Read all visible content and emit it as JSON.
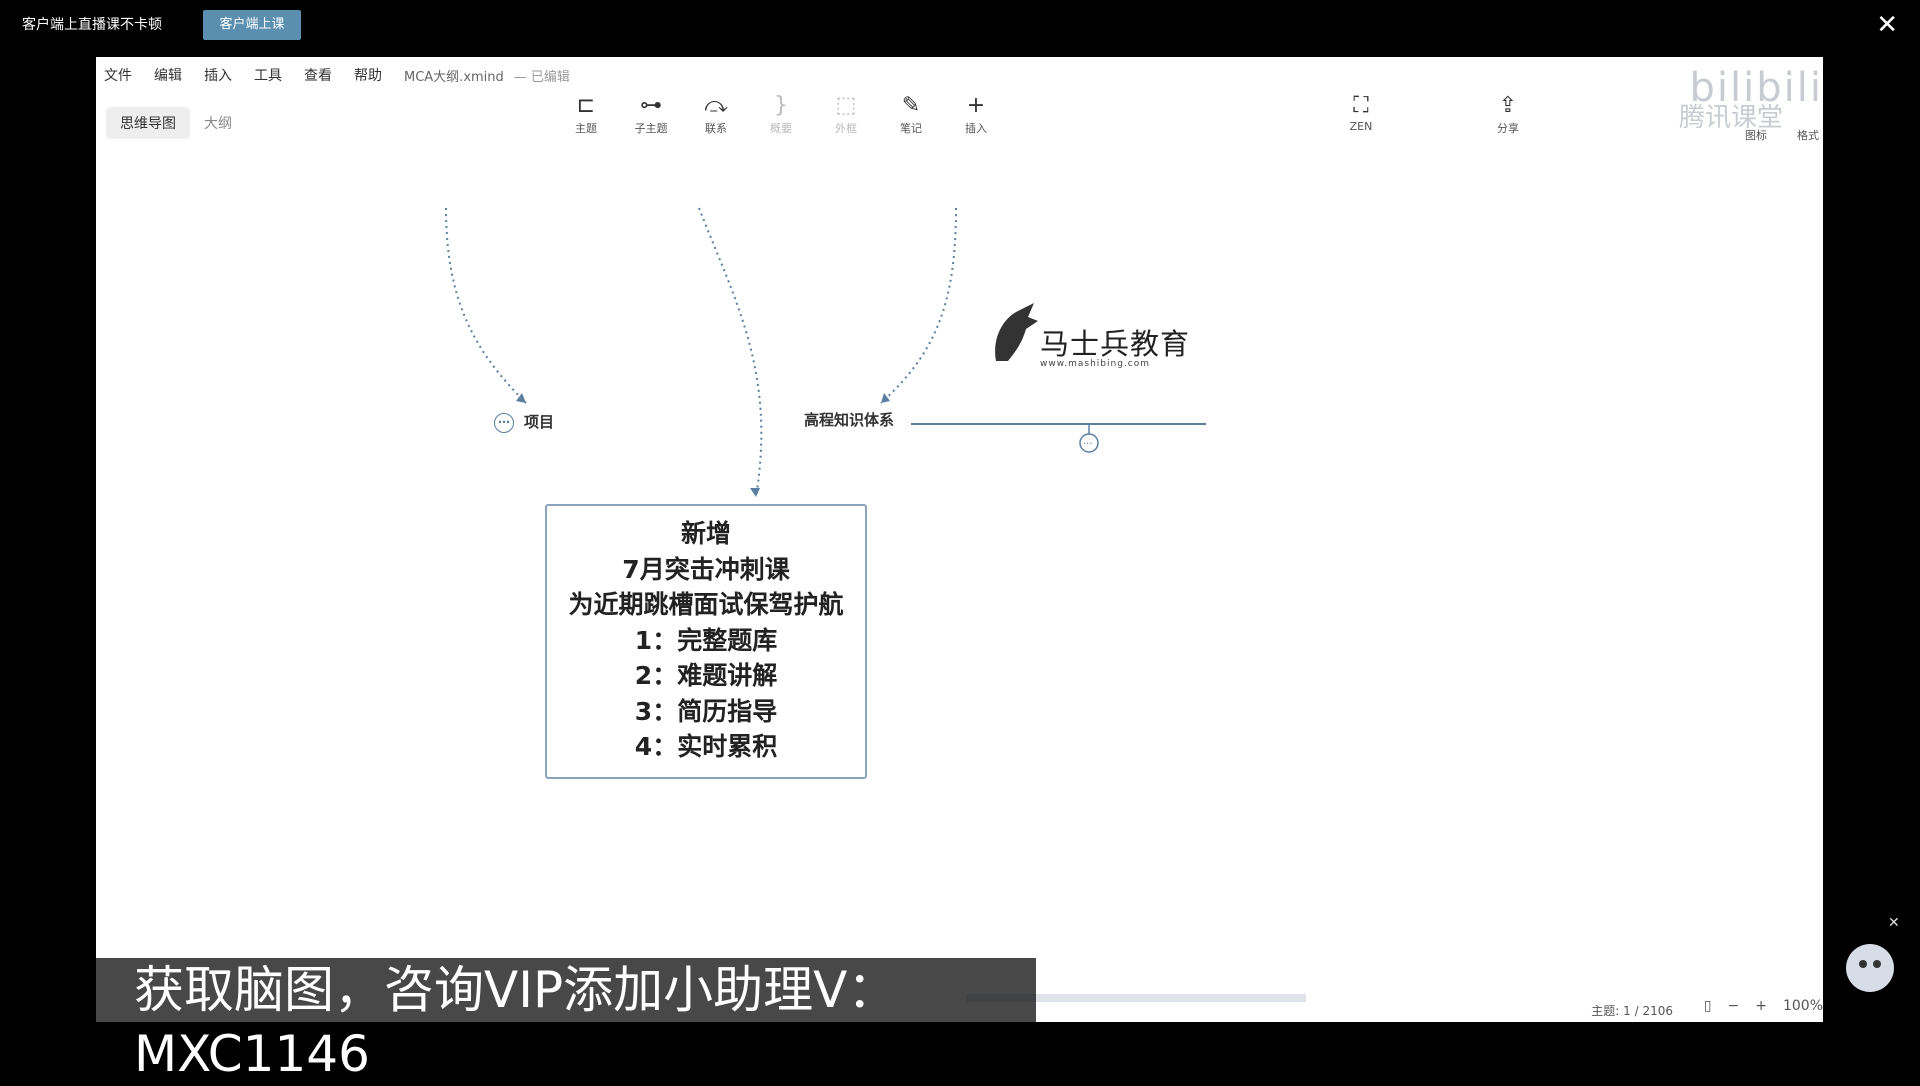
{
  "topbar": {
    "tip": "客户端上直播课不卡顿",
    "button": "客户端上课",
    "close": "✕"
  },
  "menu": [
    "文件",
    "编辑",
    "插入",
    "工具",
    "查看",
    "帮助"
  ],
  "file": {
    "name": "MCA大纲.xmind",
    "status": "— 已编辑"
  },
  "view_tabs": {
    "mindmap": "思维导图",
    "outline": "大纲"
  },
  "toolbar": [
    {
      "icon": "topic-icon",
      "glyph": "⊏",
      "label": "主题",
      "enabled": true
    },
    {
      "icon": "subtopic-icon",
      "glyph": "⊶",
      "label": "子主题",
      "enabled": true
    },
    {
      "icon": "relationship-icon",
      "glyph": "⤼",
      "label": "联系",
      "enabled": true
    },
    {
      "icon": "summary-icon",
      "glyph": "}",
      "label": "概要",
      "enabled": false
    },
    {
      "icon": "boundary-icon",
      "glyph": "⬚",
      "label": "外框",
      "enabled": false
    },
    {
      "icon": "note-icon",
      "glyph": "✎",
      "label": "笔记",
      "enabled": true
    },
    {
      "icon": "insert-icon",
      "glyph": "+",
      "label": "插入",
      "enabled": true
    }
  ],
  "zen": {
    "glyph": "⛶",
    "label": "ZEN"
  },
  "share": {
    "glyph": "⇪",
    "label": "分享"
  },
  "right_tools": {
    "icon_label": "图标",
    "format_label": "格式"
  },
  "watermark": {
    "brand": "bilibili",
    "sub": "腾讯课堂"
  },
  "nodes": {
    "project": "项目",
    "system": "高程知识体系"
  },
  "logo": {
    "name": "马士兵教育",
    "url": "www.mashibing.com"
  },
  "note_lines": [
    "新增",
    "7月突击冲刺课",
    "为近期跳槽面试保驾护航",
    "1：完整题库",
    "2：难题讲解",
    "3：简历指导",
    "4：实时累积"
  ],
  "status": {
    "topics": "主题: 1 / 2106",
    "zoom": "100%"
  },
  "subtitle": "获取脑图，咨询VIP添加小助理V：MXC1146"
}
